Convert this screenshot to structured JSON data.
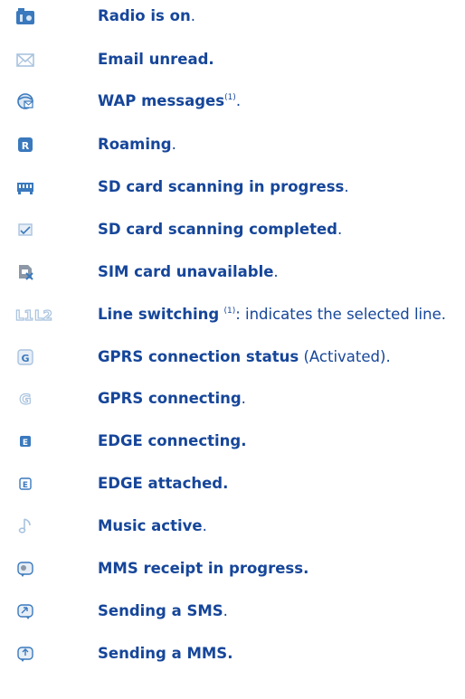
{
  "colors": {
    "text": "#16469a",
    "icon_primary": "#3a79bd",
    "icon_light": "#a9c3df",
    "icon_grey": "#8c98a6"
  },
  "items": [
    {
      "icon": "radio-icon",
      "bold": "Radio is on",
      "mid": "",
      "sup": "",
      "rest": "."
    },
    {
      "icon": "email-unread-icon",
      "bold": "Email unread.",
      "mid": "",
      "sup": "",
      "rest": ""
    },
    {
      "icon": "wap-message-icon",
      "bold": "WAP messages",
      "mid": "",
      "sup": "(1)",
      "rest": "."
    },
    {
      "icon": "roaming-icon",
      "bold": "Roaming",
      "mid": "",
      "sup": "",
      "rest": "."
    },
    {
      "icon": "sd-card-scanning-icon",
      "bold": "SD card scanning in progress",
      "mid": "",
      "sup": "",
      "rest": "."
    },
    {
      "icon": "sd-card-scan-completed-icon",
      "bold": "SD card scanning completed",
      "mid": "",
      "sup": "",
      "rest": "."
    },
    {
      "icon": "sim-unavailable-icon",
      "bold": "SIM card unavailable",
      "mid": "",
      "sup": "",
      "rest": "."
    },
    {
      "icon": "line-switching-icon",
      "bold": "Line switching",
      "mid": " ",
      "sup": "(1)",
      "rest": ": indicates the selected line."
    },
    {
      "icon": "gprs-status-icon",
      "bold": "GPRS connection status",
      "mid": " (Activated)",
      "sup": "",
      "rest": "."
    },
    {
      "icon": "gprs-connecting-icon",
      "bold": "GPRS connecting",
      "mid": "",
      "sup": "",
      "rest": "."
    },
    {
      "icon": "edge-connecting-icon",
      "bold": "EDGE connecting.",
      "mid": "",
      "sup": "",
      "rest": ""
    },
    {
      "icon": "edge-attached-icon",
      "bold": "EDGE attached.",
      "mid": "",
      "sup": "",
      "rest": ""
    },
    {
      "icon": "music-active-icon",
      "bold": "Music active",
      "mid": "",
      "sup": "",
      "rest": "."
    },
    {
      "icon": "mms-receipt-icon",
      "bold": "MMS receipt in progress.",
      "mid": "",
      "sup": "",
      "rest": ""
    },
    {
      "icon": "sending-sms-icon",
      "bold": "Sending a SMS",
      "mid": "",
      "sup": "",
      "rest": "."
    },
    {
      "icon": "sending-mms-icon",
      "bold": "Sending a MMS.",
      "mid": "",
      "sup": "",
      "rest": ""
    }
  ]
}
